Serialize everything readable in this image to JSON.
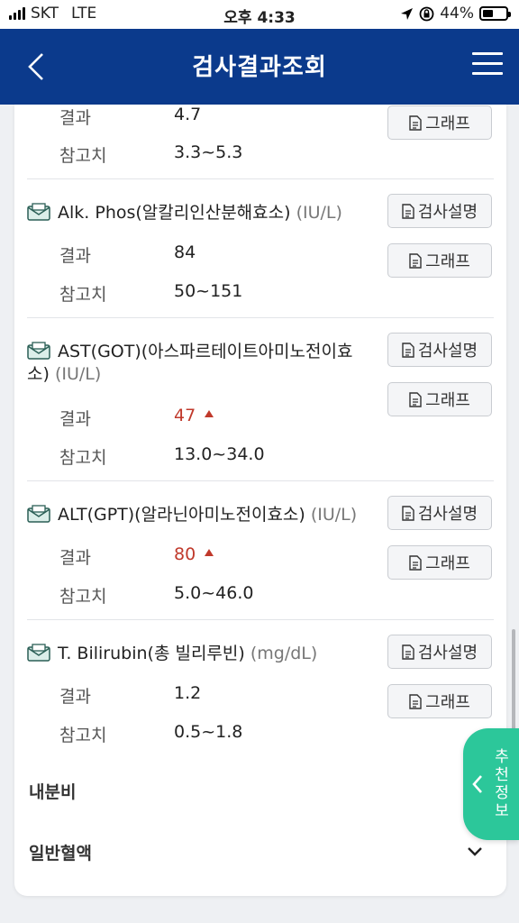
{
  "status": {
    "carrier": "SKT",
    "network": "LTE",
    "time": "오후 4:33",
    "battery": "44%",
    "battery_level": 0.44
  },
  "header": {
    "title": "검사결과조회"
  },
  "labels": {
    "result": "결과",
    "reference": "참고치",
    "explain_button": "검사설명",
    "graph_button": "그래프"
  },
  "partial": {
    "result": "4.7",
    "reference": "3.3~5.3"
  },
  "items": [
    {
      "name": "Alk. Phos(알칼리인산분해효소)",
      "unit": "(IU/L)",
      "result": "84",
      "reference": "50~151",
      "high": false
    },
    {
      "name": "AST(GOT)(아스파르테이트아미노전이효소)",
      "unit": "(IU/L)",
      "result": "47",
      "reference": "13.0~34.0",
      "high": true
    },
    {
      "name": "ALT(GPT)(알라닌아미노전이효소)",
      "unit": "(IU/L)",
      "result": "80",
      "reference": "5.0~46.0",
      "high": true
    },
    {
      "name": "T. Bilirubin(총 빌리루빈)",
      "unit": "(mg/dL)",
      "result": "1.2",
      "reference": "0.5~1.8",
      "high": false
    }
  ],
  "sections": {
    "endocrine": "내분비",
    "cbc": "일반혈액"
  },
  "recommend_tab": {
    "label": "추천정보"
  },
  "colors": {
    "header": "#0b3a8c",
    "high": "#c0392b",
    "accent": "#2cc79a"
  }
}
